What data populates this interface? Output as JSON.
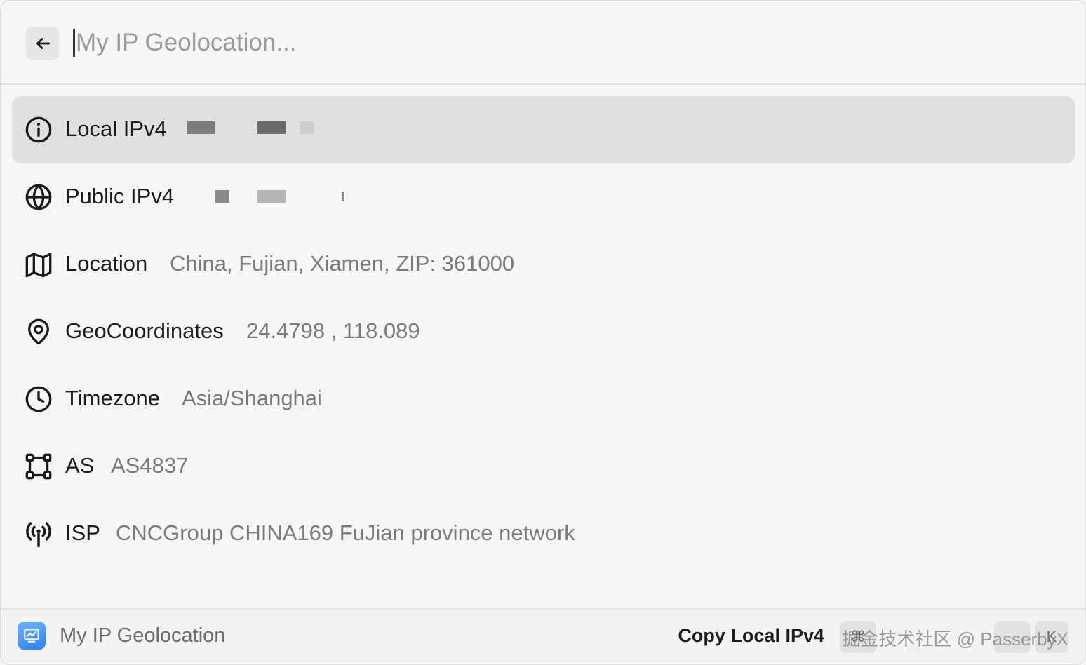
{
  "search": {
    "placeholder": "My IP Geolocation...",
    "value": ""
  },
  "icons": {
    "back": "arrow-left-icon",
    "info": "info-circle-icon",
    "globe": "globe-icon",
    "map": "map-icon",
    "pin": "map-pin-icon",
    "clock": "clock-icon",
    "as": "network-nodes-icon",
    "isp": "broadcast-antenna-icon",
    "app": "chart-window-icon"
  },
  "rows": [
    {
      "label": "Local IPv4",
      "value": ""
    },
    {
      "label": "Public IPv4",
      "value": ""
    },
    {
      "label": "Location",
      "value": "China, Fujian, Xiamen, ZIP: 361000"
    },
    {
      "label": "GeoCoordinates",
      "value": "24.4798 , 118.089"
    },
    {
      "label": "Timezone",
      "value": "Asia/Shanghai"
    },
    {
      "label": "AS",
      "value": "AS4837"
    },
    {
      "label": "ISP",
      "value": "CNCGroup CHINA169 FuJian province network"
    }
  ],
  "footer": {
    "app_name": "My IP Geolocation",
    "action_label": "Copy Local IPv4",
    "kbd_1": "⌘",
    "kbd_2": "K",
    "watermark": "掘金技术社区 @ PasserbyX"
  },
  "colors": {
    "selected_row": "#e0e0e0",
    "label_text": "#1c1c1c",
    "value_text": "#7a7a7a",
    "app_icon": "#3d8ef5"
  }
}
